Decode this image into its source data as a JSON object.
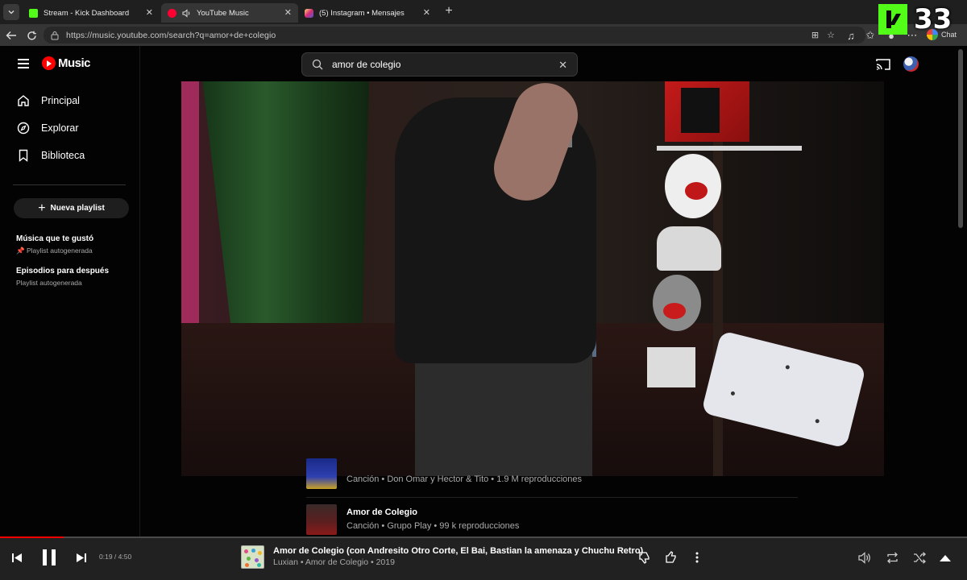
{
  "browser": {
    "tabs": [
      {
        "title": "Stream - Kick Dashboard",
        "favicon_color": "#53fc18"
      },
      {
        "title": "YouTube Music",
        "favicon_color": "#ff0033"
      },
      {
        "title": "(5) Instagram • Mensajes",
        "favicon_color": "#d62976"
      }
    ],
    "url": "https://music.youtube.com/search?q=amor+de+colegio",
    "chat_label": "Chat",
    "overlay_count": "33"
  },
  "sidebar": {
    "logo_text": "Music",
    "nav": [
      {
        "label": "Principal",
        "icon": "home-icon"
      },
      {
        "label": "Explorar",
        "icon": "compass-icon"
      },
      {
        "label": "Biblioteca",
        "icon": "library-icon"
      }
    ],
    "new_playlist_label": "Nueva playlist",
    "playlists": [
      {
        "title": "Música que te gustó",
        "subtitle": "Playlist autogenerada",
        "pinned": true
      },
      {
        "title": "Episodios para después",
        "subtitle": "Playlist autogenerada",
        "pinned": false
      }
    ]
  },
  "search": {
    "value": "amor de colegio"
  },
  "results": [
    {
      "title": "",
      "subtitle": "Canción • Don Omar y Hector & Tito • 1.9 M reproducciones"
    },
    {
      "title": "Amor de Colegio",
      "subtitle": "Canción • Grupo Play • 99 k reproducciones"
    }
  ],
  "player": {
    "time": "0:19 / 4:50",
    "progress_fraction": 0.066,
    "title": "Amor de Colegio (con Andresito Otro Corte, El Bai, Bastian la amenaza y Chuchu Retro)",
    "subtitle": "Luxian • Amor de Colegio • 2019",
    "state": "playing"
  },
  "colors": {
    "accent": "#ff0000",
    "background": "#030303",
    "player_bg": "#212121"
  }
}
